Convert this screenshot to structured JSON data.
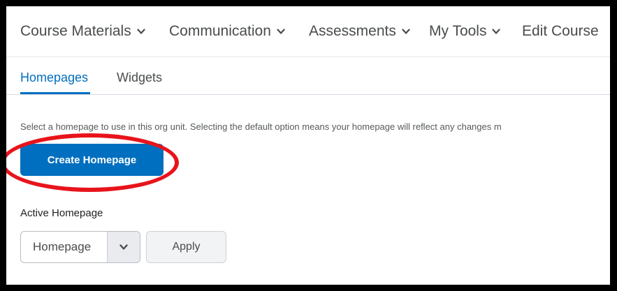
{
  "navbar": {
    "items": [
      {
        "label": "Course Materials",
        "has_dropdown": true
      },
      {
        "label": "Communication",
        "has_dropdown": true
      },
      {
        "label": "Assessments",
        "has_dropdown": true
      },
      {
        "label": "My Tools",
        "has_dropdown": true
      },
      {
        "label": "Edit Course",
        "has_dropdown": false
      }
    ]
  },
  "tabs": [
    {
      "label": "Homepages",
      "active": true
    },
    {
      "label": "Widgets",
      "active": false
    }
  ],
  "main": {
    "help_text": "Select a homepage to use in this org unit. Selecting the default option means your homepage will reflect any changes m",
    "create_button_label": "Create Homepage",
    "active_homepage_label": "Active Homepage",
    "active_homepage_value": "Homepage",
    "apply_label": "Apply"
  },
  "colors": {
    "accent": "#006fbf",
    "highlight_ring": "#e8141b",
    "frame_border": "#000000"
  },
  "icons": {
    "dropdown": "chevron-down-icon"
  }
}
